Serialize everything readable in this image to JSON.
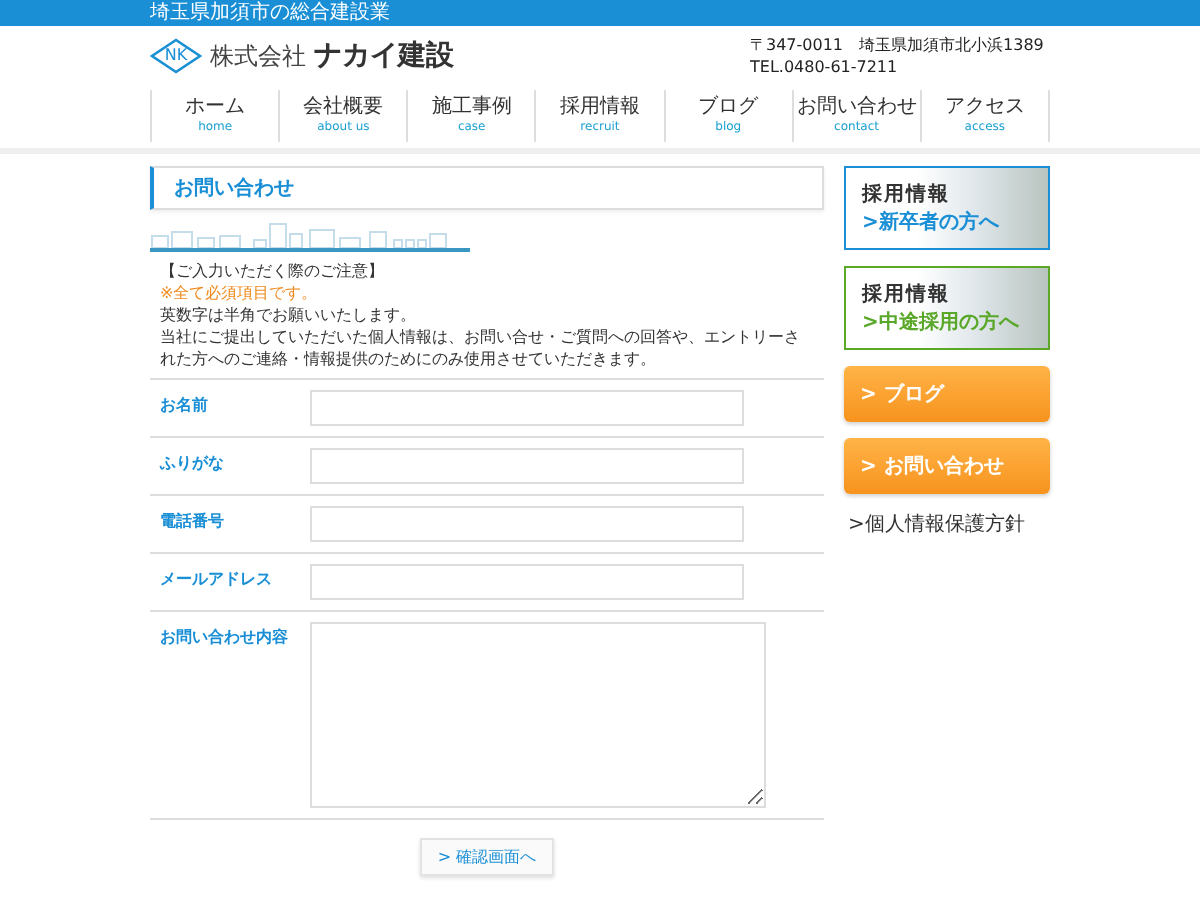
{
  "top_bar": {
    "text": "埼玉県加須市の総合建設業"
  },
  "header": {
    "logo": {
      "mark": "NK",
      "company": "株式会社",
      "name": "ナカイ建設"
    },
    "address": "〒347-0011　埼玉県加須市北小浜1389",
    "tel": "TEL.0480-61-7211"
  },
  "nav": [
    {
      "label": "ホーム",
      "sub": "home"
    },
    {
      "label": "会社概要",
      "sub": "about us"
    },
    {
      "label": "施工事例",
      "sub": "case"
    },
    {
      "label": "採用情報",
      "sub": "recruit"
    },
    {
      "label": "ブログ",
      "sub": "blog"
    },
    {
      "label": "お問い合わせ",
      "sub": "contact"
    },
    {
      "label": "アクセス",
      "sub": "access"
    }
  ],
  "page_title": "お問い合わせ",
  "notice": {
    "heading": "【ご入力いただく際のご注意】",
    "required": "※全て必須項目です。",
    "lines": [
      "英数字は半角でお願いいたします。",
      "当社にご提出していただいた個人情報は、お問い合せ・ご質問への回答や、エントリーされた方へのご連絡・情報提供のためにのみ使用させていただきます。"
    ]
  },
  "form": {
    "fields": [
      {
        "label": "お名前",
        "kind": "text"
      },
      {
        "label": "ふりがな",
        "kind": "text"
      },
      {
        "label": "電話番号",
        "kind": "text"
      },
      {
        "label": "メールアドレス",
        "kind": "text"
      },
      {
        "label": "お問い合わせ内容",
        "kind": "textarea"
      }
    ],
    "submit": "> 確認画面へ"
  },
  "sidebar": {
    "banners": [
      {
        "title": "採用情報",
        "link": ">新卒者の方へ",
        "color": "#1a8fd6"
      },
      {
        "title": "採用情報",
        "link": ">中途採用の方へ",
        "color": "#5aa829"
      }
    ],
    "buttons": [
      "> ブログ",
      "> お問い合わせ"
    ],
    "link": ">個人情報保護方針"
  }
}
